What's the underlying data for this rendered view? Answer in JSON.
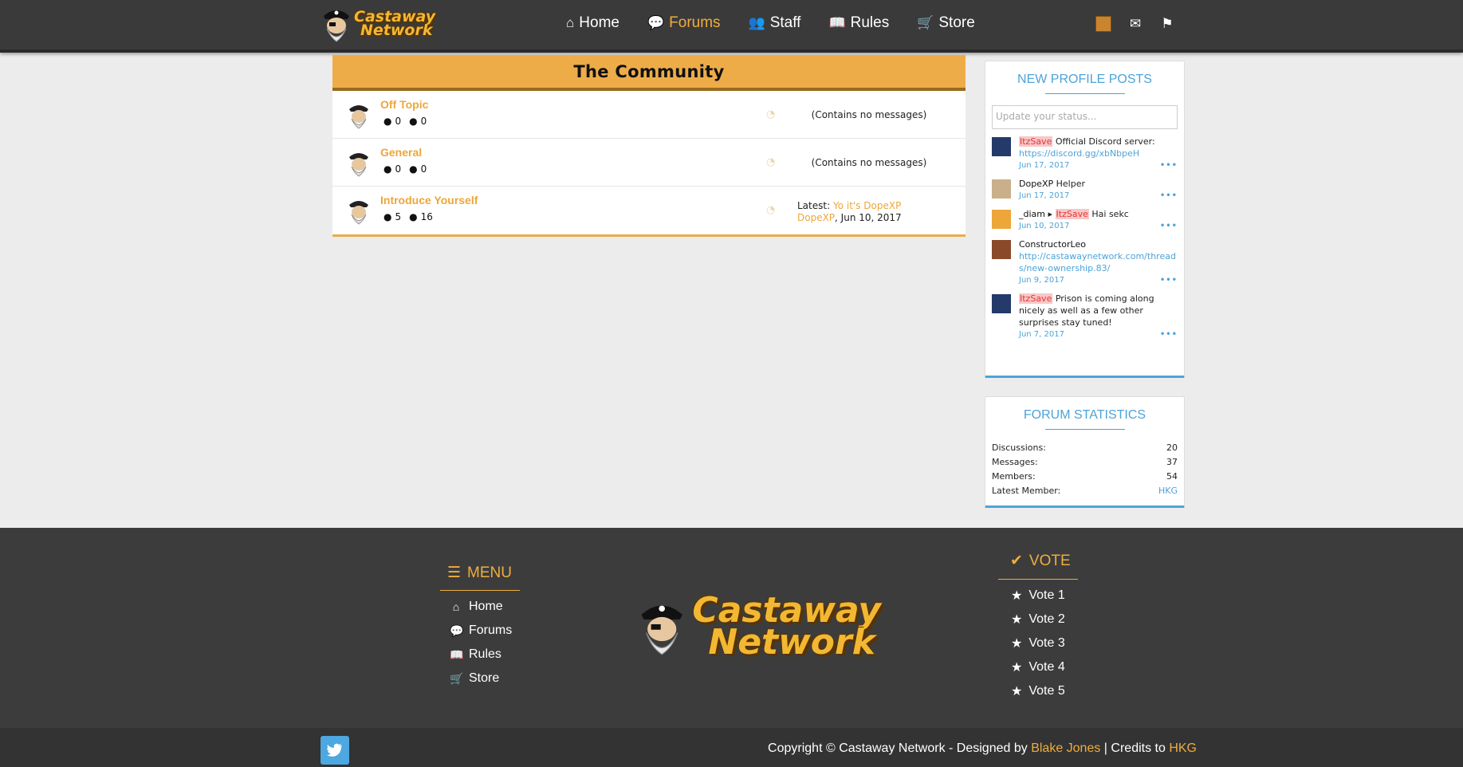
{
  "header": {
    "logo_line1": "Castaway",
    "logo_line2": "Network",
    "nav": [
      {
        "label": "Home",
        "icon": "home-icon"
      },
      {
        "label": "Forums",
        "icon": "comments-icon",
        "active": true
      },
      {
        "label": "Staff",
        "icon": "users-icon"
      },
      {
        "label": "Rules",
        "icon": "book-icon"
      },
      {
        "label": "Store",
        "icon": "cart-icon"
      }
    ],
    "accent": "#f0ad3d"
  },
  "category": {
    "title": "The Community",
    "nodes": [
      {
        "title": "Off Topic",
        "discussions": "0",
        "messages": "0",
        "last": "(Contains no messages)"
      },
      {
        "title": "General",
        "discussions": "0",
        "messages": "0",
        "last": "(Contains no messages)"
      },
      {
        "title": "Introduce Yourself",
        "discussions": "5",
        "messages": "16",
        "latest_label": "Latest:",
        "latest_thread": "Yo it's DopeXP",
        "latest_user": "DopeXP",
        "latest_date": ", Jun 10, 2017"
      }
    ]
  },
  "profile_posts": {
    "title": "NEW PROFILE POSTS",
    "placeholder": "Update your status...",
    "posts": [
      {
        "user": "ItzSave",
        "text": "Official Discord server:",
        "link": "https://discord.gg/xbNbpeH",
        "date": "Jun 17, 2017"
      },
      {
        "user": "DopeXP",
        "text": "Helper",
        "date": "Jun 17, 2017"
      },
      {
        "user": "_diam",
        "arrow": "▸",
        "target": "ItzSave",
        "text": "Hai sekc",
        "date": "Jun 10, 2017"
      },
      {
        "user": "ConstructorLeo",
        "link": "http://castawaynetwork.com/threads/new-ownership.83/",
        "date": "Jun 9, 2017"
      },
      {
        "user": "ItzSave",
        "text": "Prison is coming along nicely as well as a few other surprises stay tuned!",
        "date": "Jun 7, 2017"
      }
    ],
    "more": "•••"
  },
  "forum_stats": {
    "title": "FORUM STATISTICS",
    "rows": [
      {
        "label": "Discussions:",
        "value": "20"
      },
      {
        "label": "Messages:",
        "value": "37"
      },
      {
        "label": "Members:",
        "value": "54"
      },
      {
        "label": "Latest Member:",
        "value": "HKG"
      }
    ]
  },
  "footer": {
    "menu_title": "MENU",
    "menu": [
      {
        "label": "Home",
        "icon": "home-icon"
      },
      {
        "label": "Forums",
        "icon": "comments-icon"
      },
      {
        "label": "Rules",
        "icon": "book-icon"
      },
      {
        "label": "Store",
        "icon": "cart-icon"
      }
    ],
    "vote_title": "VOTE",
    "votes": [
      "Vote 1",
      "Vote 2",
      "Vote 3",
      "Vote 4",
      "Vote 5"
    ],
    "copyright_pre": "Copyright © Castaway Network - Designed by ",
    "designer": "Blake Jones",
    "credits_pre": " | Credits to ",
    "credits": "HKG"
  }
}
